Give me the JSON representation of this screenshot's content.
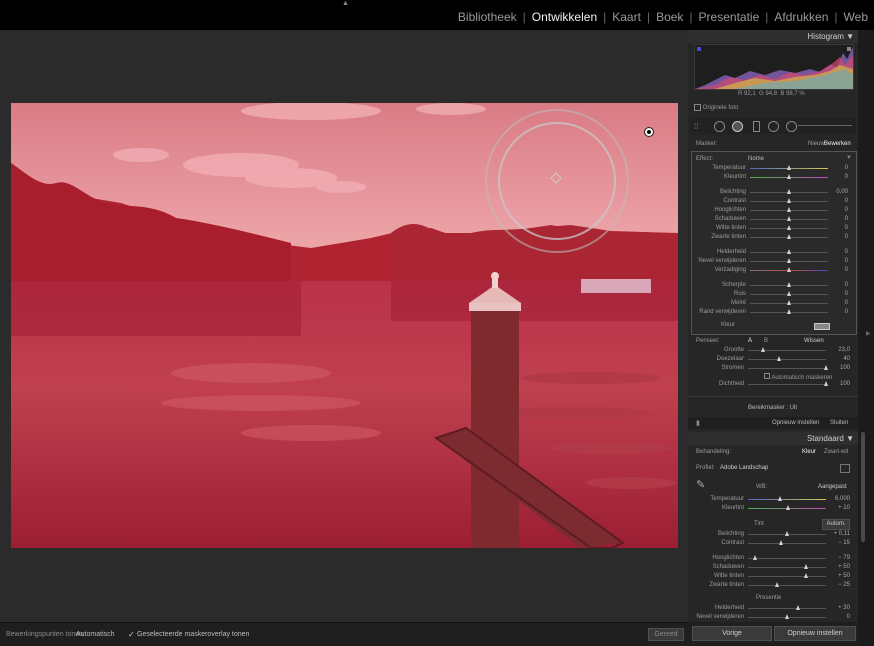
{
  "modules": [
    "Bibliotheek",
    "Ontwikkelen",
    "Kaart",
    "Boek",
    "Presentatie",
    "Afdrukken",
    "Web"
  ],
  "active_module": "Ontwikkelen",
  "histogram": {
    "title": "Histogram",
    "rgb": [
      "92,1",
      "94,8",
      "98,7"
    ],
    "unit": "%",
    "original_photo": "Originele foto"
  },
  "mask": {
    "label": "Masker:",
    "new": "Nieuw",
    "edit": "Bewerken",
    "effect_label": "Effect:",
    "effect_value": "Nome"
  },
  "local_sliders": [
    {
      "label": "Temperatuur",
      "value": "0",
      "pos": 0.5,
      "kind": "temp"
    },
    {
      "label": "Kleurtint",
      "value": "0",
      "pos": 0.5,
      "kind": "tint"
    },
    {
      "label": "Belichting",
      "value": "0,00",
      "pos": 0.5
    },
    {
      "label": "Contrast",
      "value": "0",
      "pos": 0.5
    },
    {
      "label": "Hooglichten",
      "value": "0",
      "pos": 0.5
    },
    {
      "label": "Schaduwen",
      "value": "0",
      "pos": 0.5
    },
    {
      "label": "Witte tinten",
      "value": "0",
      "pos": 0.5
    },
    {
      "label": "Zwarte tinten",
      "value": "0",
      "pos": 0.5
    },
    {
      "label": "Helderheid",
      "value": "0",
      "pos": 0.5
    },
    {
      "label": "Nevel verwijderen",
      "value": "0",
      "pos": 0.5
    },
    {
      "label": "Verzadiging",
      "value": "0",
      "pos": 0.5,
      "kind": "sat"
    },
    {
      "label": "Scherpte",
      "value": "0",
      "pos": 0.5
    },
    {
      "label": "Ruis",
      "value": "0",
      "pos": 0.5
    },
    {
      "label": "Moiré",
      "value": "0",
      "pos": 0.5
    },
    {
      "label": "Rand verwijderen",
      "value": "0",
      "pos": 0.5
    }
  ],
  "color_label": "Kleur",
  "brush": {
    "label": "Penseel:",
    "a": "A",
    "b": "B",
    "erase": "Wissen",
    "size": {
      "label": "Grootte",
      "value": "23,0",
      "pos": 0.2
    },
    "feather": {
      "label": "Doezelaar",
      "value": "40",
      "pos": 0.4
    },
    "flow": {
      "label": "Stromen",
      "value": "100",
      "pos": 1.0
    },
    "auto_mask": "Automatisch maskeren",
    "density": {
      "label": "Dichtheid",
      "value": "100",
      "pos": 1.0
    }
  },
  "range_mask": "Bereikmasker : Uit",
  "reset": "Opnieuw instellen",
  "close": "Sluiten",
  "preset": "Standaard",
  "basic": {
    "treatment_label": "Behandeling:",
    "color": "Kleur",
    "bw": "Zwart-wit",
    "profile_label": "Profiel:",
    "profile_value": "Adobe Landschap",
    "wb_label": "WB:",
    "wb_value": "Aangepast",
    "temp": {
      "label": "Temperatuur",
      "value": "6.000",
      "pos": 0.42
    },
    "tint": {
      "label": "Kleurtint",
      "value": "+ 10",
      "pos": 0.52
    },
    "tone": "Tint",
    "auto": "Autom.",
    "exposure": {
      "label": "Belichting",
      "value": "+ 0,11",
      "pos": 0.5
    },
    "contrast": {
      "label": "Contrast",
      "value": "− 15",
      "pos": 0.43
    },
    "highlights": {
      "label": "Hooglichten",
      "value": "− 79",
      "pos": 0.1
    },
    "shadows": {
      "label": "Schaduwen",
      "value": "+ 50",
      "pos": 0.75
    },
    "whites": {
      "label": "Witte tinten",
      "value": "+ 50",
      "pos": 0.75
    },
    "blacks": {
      "label": "Zwarte tinten",
      "value": "− 25",
      "pos": 0.38
    },
    "presence": "Presentie",
    "clarity": {
      "label": "Helderheid",
      "value": "+ 30",
      "pos": 0.65
    },
    "dehaze": {
      "label": "Nevel verwijderen",
      "value": "0",
      "pos": 0.5
    }
  },
  "bottom": {
    "pins_label": "Bewerkingspunten tonen:",
    "pins_value": "Automatisch",
    "overlay": "Geselecteerde maskeroverlay tonen",
    "done": "Gereed",
    "prev": "Vorige",
    "reset": "Opnieuw instellen"
  },
  "colors": {
    "mask_overlay": "#c22a3a",
    "sky": "#e08a93",
    "accent": "#f2f2f2"
  }
}
